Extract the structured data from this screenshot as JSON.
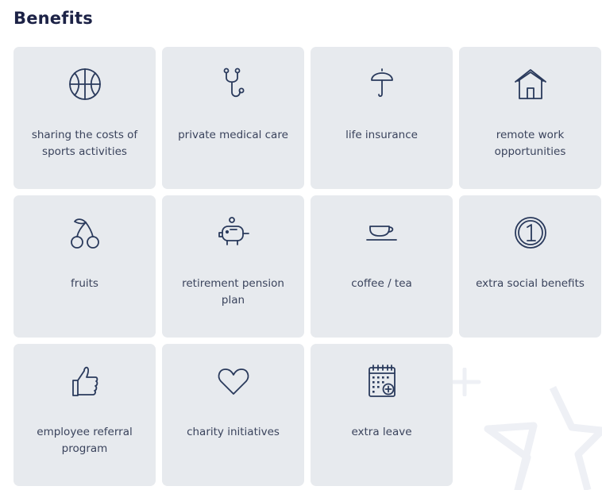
{
  "section": {
    "title": "Benefits"
  },
  "colors": {
    "card_bg": "#e7eaee",
    "icon_stroke": "#2a3a5c",
    "title": "#1c2246",
    "label": "#3a435c"
  },
  "benefits": [
    {
      "label": "sharing the costs of sports activities",
      "icon": "basketball-icon"
    },
    {
      "label": "private medical care",
      "icon": "stethoscope-icon"
    },
    {
      "label": "life insurance",
      "icon": "umbrella-icon"
    },
    {
      "label": "remote work opportunities",
      "icon": "house-icon"
    },
    {
      "label": "fruits",
      "icon": "cherries-icon"
    },
    {
      "label": "retirement pension plan",
      "icon": "piggy-bank-icon"
    },
    {
      "label": "coffee / tea",
      "icon": "coffee-cup-icon"
    },
    {
      "label": "extra social benefits",
      "icon": "coin-icon"
    },
    {
      "label": "employee referral program",
      "icon": "thumbs-up-icon"
    },
    {
      "label": "charity initiatives",
      "icon": "heart-icon"
    },
    {
      "label": "extra leave",
      "icon": "calendar-plus-icon"
    }
  ]
}
